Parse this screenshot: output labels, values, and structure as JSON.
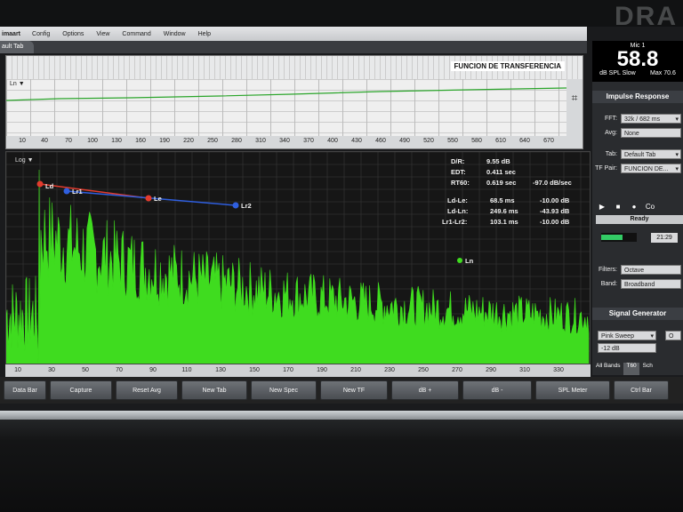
{
  "menu": {
    "app": "imaart",
    "items": [
      "Config",
      "Options",
      "View",
      "Command",
      "Window",
      "Help"
    ]
  },
  "tab": {
    "label": "ault Tab"
  },
  "transfer": {
    "title": "FUNCION DE TRANSFERENCIA",
    "mode_label": "Ln ▼",
    "x_ticks": [
      "10",
      "40",
      "70",
      "100",
      "130",
      "160",
      "190",
      "220",
      "250",
      "280",
      "310",
      "340",
      "370",
      "400",
      "430",
      "460",
      "490",
      "520",
      "550",
      "580",
      "610",
      "640",
      "670"
    ]
  },
  "impulse": {
    "scale_label": "Log ▼",
    "stats": [
      {
        "label": "D/R:",
        "value": "9.55 dB",
        "extra": ""
      },
      {
        "label": "EDT:",
        "value": "0.411 sec",
        "extra": ""
      },
      {
        "label": "RT60:",
        "value": "0.619 sec",
        "extra": "-97.0 dB/sec"
      }
    ],
    "deltas": [
      {
        "label": "Ld-Le:",
        "value": "68.5 ms",
        "extra": "-10.00 dB"
      },
      {
        "label": "Ld-Ln:",
        "value": "249.6 ms",
        "extra": "-43.93 dB"
      },
      {
        "label": "Lr1-Lr2:",
        "value": "103.1 ms",
        "extra": "-10.00 dB"
      }
    ],
    "markers": [
      "Ld",
      "Lr1",
      "Le",
      "Lr2",
      "Ln"
    ],
    "x_ticks": [
      "10",
      "30",
      "50",
      "70",
      "90",
      "110",
      "130",
      "150",
      "170",
      "190",
      "210",
      "230",
      "250",
      "270",
      "290",
      "310",
      "330"
    ]
  },
  "toolbar": [
    "Data Bar",
    "Capture",
    "Reset Avg",
    "New Tab",
    "New Spec",
    "New TF",
    "dB +",
    "dB -",
    "SPL Meter",
    "Ctrl Bar"
  ],
  "meter": {
    "name": "Mic 1",
    "value": "58.8",
    "mode": "dB SPL Slow",
    "max": "Max 70.6"
  },
  "impulse_response": {
    "title": "Impulse Response",
    "fft_label": "FFT:",
    "fft_value": "32k / 682 ms",
    "avg_label": "Avg:",
    "avg_value": "None",
    "tab_label": "Tab:",
    "tab_value": "Default Tab",
    "tfpair_label": "TF Pair:",
    "tfpair_value": "FUNCION DE...",
    "transport": [
      "▶",
      "■",
      "●",
      "Co"
    ],
    "status": "Ready",
    "time": "21:29",
    "filters_label": "Filters:",
    "filters_value": "Octave",
    "band_label": "Band:",
    "band_value": "Broadband"
  },
  "signal_generator": {
    "title": "Signal Generator",
    "type": "Pink Sweep",
    "level": "-12 dB",
    "side": "O"
  },
  "bands": [
    "All Bands",
    "T60",
    "Sch"
  ],
  "bezel_logo": "DRA",
  "colors": {
    "accent_green": "#3fdc1f",
    "marker_red": "#e23b2e",
    "marker_blue": "#2f5fe0",
    "transfer_line": "#2aa52a"
  }
}
